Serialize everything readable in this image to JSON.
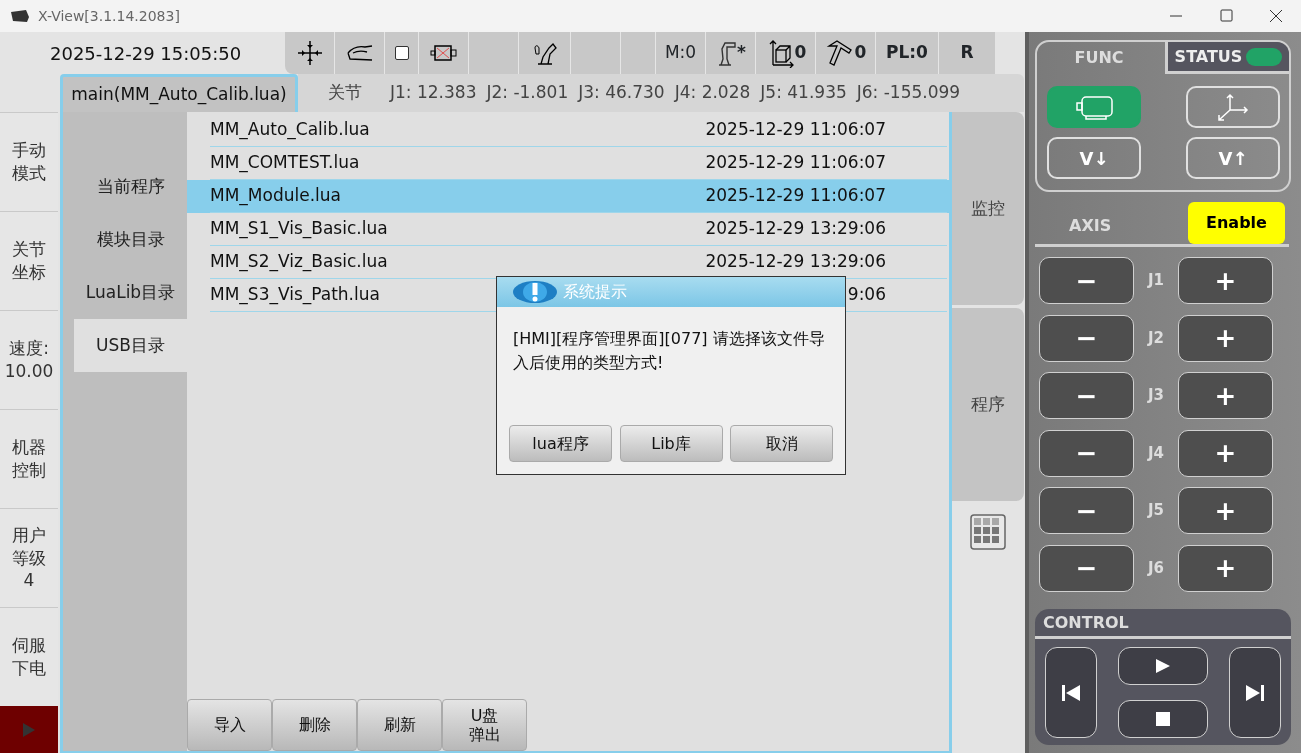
{
  "window": {
    "title": "X-View[3.1.14.2083]"
  },
  "datetime": "2025-12-29 15:05:50",
  "toolbar": [
    {
      "kind": "crosshair"
    },
    {
      "kind": "hand"
    },
    {
      "kind": "checkbox",
      "checked": false
    },
    {
      "kind": "motor_off"
    },
    {
      "kind": "blank"
    },
    {
      "kind": "robot_hand"
    },
    {
      "kind": "blank"
    },
    {
      "kind": "blank"
    },
    {
      "kind": "text",
      "text": "M:0"
    },
    {
      "kind": "robot",
      "text": "*"
    },
    {
      "kind": "frame",
      "text": "0"
    },
    {
      "kind": "tool",
      "text": "0"
    },
    {
      "kind": "strong",
      "text": "PL:0"
    },
    {
      "kind": "strong",
      "text": "R"
    }
  ],
  "left_nav": [
    {
      "kind": "text",
      "lines": [
        "手动",
        "模式"
      ]
    },
    {
      "kind": "text",
      "lines": [
        "关节",
        "坐标"
      ]
    },
    {
      "kind": "text",
      "lines": [
        "速度:",
        "10.00"
      ]
    },
    {
      "kind": "text",
      "lines": [
        "机器",
        "控制"
      ]
    },
    {
      "kind": "text",
      "lines": [
        "用户",
        "等级",
        "4"
      ]
    },
    {
      "kind": "text",
      "lines": [
        "伺服",
        "下电"
      ]
    },
    {
      "kind": "run"
    }
  ],
  "program_tab": {
    "label": "main(MM_Auto_Calib.lua)",
    "selected": true
  },
  "joints": {
    "label": "关节",
    "values": [
      {
        "name": "J1:",
        "value": "12.383"
      },
      {
        "name": "J2:",
        "value": "-1.801"
      },
      {
        "name": "J3:",
        "value": "46.730"
      },
      {
        "name": "J4:",
        "value": "2.028"
      },
      {
        "name": "J5:",
        "value": "41.935"
      },
      {
        "name": "J6:",
        "value": "-155.099"
      }
    ]
  },
  "categories": [
    {
      "label": "当前程序",
      "selected": false
    },
    {
      "label": "模块目录",
      "selected": false
    },
    {
      "label": "LuaLib目录",
      "selected": false
    },
    {
      "label": "USB目录",
      "selected": true
    }
  ],
  "files": [
    {
      "name": "MM_Auto_Calib.lua",
      "date": "2025-12-29 11:06:07",
      "selected": false
    },
    {
      "name": "MM_COMTEST.lua",
      "date": "2025-12-29 11:06:07",
      "selected": false
    },
    {
      "name": "MM_Module.lua",
      "date": "2025-12-29 11:06:07",
      "selected": true
    },
    {
      "name": "MM_S1_Vis_Basic.lua",
      "date": "2025-12-29 13:29:06",
      "selected": false
    },
    {
      "name": "MM_S2_Viz_Basic.lua",
      "date": "2025-12-29 13:29:06",
      "selected": false
    },
    {
      "name": "MM_S3_Vis_Path.lua",
      "date": "9:06",
      "selected": false
    }
  ],
  "dialog": {
    "title": "系统提示",
    "message": "[HMI][程序管理界面][077] 请选择该文件导入后使用的类型方式!",
    "buttons": [
      "lua程序",
      "Lib库",
      "取消"
    ]
  },
  "bottom_buttons": [
    {
      "lines": [
        "导入"
      ]
    },
    {
      "lines": [
        "删除"
      ]
    },
    {
      "lines": [
        "刷新"
      ]
    },
    {
      "lines": [
        "U盘",
        "弹出"
      ]
    }
  ],
  "side_tabs": [
    {
      "kind": "text",
      "label": "监控"
    },
    {
      "kind": "text",
      "label": "程序"
    },
    {
      "kind": "grid"
    }
  ],
  "func_tabs": [
    {
      "label": "FUNC",
      "selected": true
    },
    {
      "label": "STATUS",
      "selected": false
    }
  ],
  "status_on": true,
  "func_buttons": [
    {
      "kind": "motor",
      "selected": true
    },
    {
      "kind": "axes",
      "selected": false
    },
    {
      "kind": "text",
      "label": "V↓",
      "selected": false
    },
    {
      "kind": "text",
      "label": "V↑",
      "selected": false
    }
  ],
  "axis": {
    "label": "AXIS",
    "enable": "Enable",
    "joints": [
      {
        "name": "J1",
        "minus": "−",
        "plus": "+"
      },
      {
        "name": "J2",
        "minus": "−",
        "plus": "+"
      },
      {
        "name": "J3",
        "minus": "−",
        "plus": "+"
      },
      {
        "name": "J4",
        "minus": "−",
        "plus": "+"
      },
      {
        "name": "J5",
        "minus": "−",
        "plus": "+"
      },
      {
        "name": "J6",
        "minus": "−",
        "plus": "+"
      }
    ]
  },
  "control": {
    "label": "CONTROL"
  }
}
